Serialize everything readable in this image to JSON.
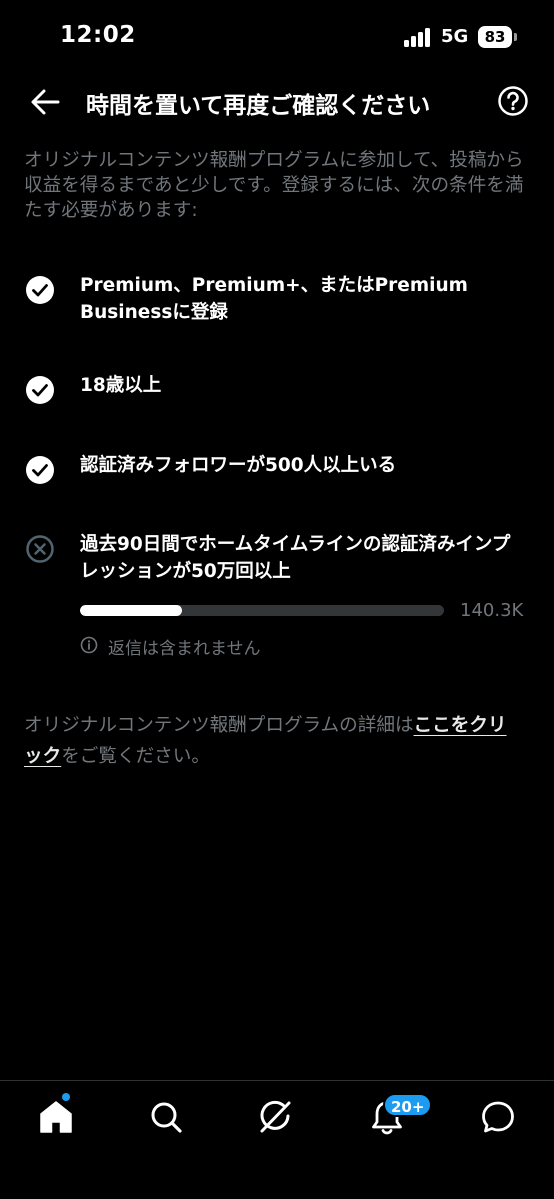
{
  "status_bar": {
    "time": "12:02",
    "network": "5G",
    "battery": "83"
  },
  "header": {
    "title": "時間を置いて再度ご確認ください"
  },
  "intro": "オリジナルコンテンツ報酬プログラムに参加して、投稿から収益を得るまであと少しです。登録するには、次の条件を満たす必要があります:",
  "requirements": [
    {
      "text": "Premium、Premium+、またはPremium Businessに登録",
      "status": "met"
    },
    {
      "text": "18歳以上",
      "status": "met"
    },
    {
      "text": "認証済みフォロワーが500人以上いる",
      "status": "met"
    },
    {
      "text": "過去90日間でホームタイムラインの認証済みインプレッションが50万回以上",
      "status": "unmet"
    }
  ],
  "progress": {
    "value_label": "140.3K",
    "fraction": 0.2806
  },
  "note": "返信は含まれません",
  "footer": {
    "prefix": "オリジナルコンテンツ報酬プログラムの詳細は",
    "link": "ここをクリック",
    "suffix": "をご覧ください。"
  },
  "nav": {
    "notifications_badge": "20+"
  },
  "colors": {
    "background": "#000000",
    "muted": "#71767b",
    "accent": "#1d9bf0",
    "track": "#333639"
  }
}
